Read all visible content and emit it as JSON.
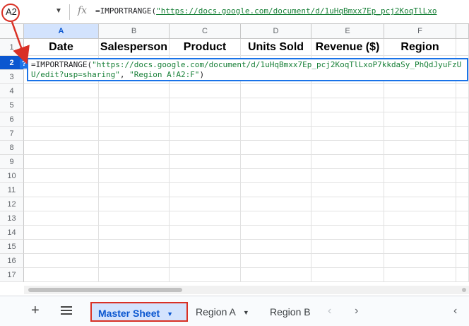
{
  "formula_bar": {
    "cell_ref": "A2",
    "fx_label": "fx",
    "formula_prefix": "=IMPORTRANGE(",
    "formula_url": "\"https://docs.google.com/document/d/1uHqBmxx7Ep_pcj2KoqTlLxo"
  },
  "grid": {
    "columns": [
      "A",
      "B",
      "C",
      "D",
      "E",
      "F"
    ],
    "rows": [
      "1",
      "2",
      "3",
      "4",
      "5",
      "6",
      "7",
      "8",
      "9",
      "10",
      "11",
      "12",
      "13",
      "14",
      "15",
      "16",
      "17"
    ],
    "header_row": [
      "Date",
      "Salesperson",
      "Product",
      "Units Sold",
      "Revenue ($)",
      "Region"
    ],
    "selected_column": "A",
    "selected_row": "2"
  },
  "editor": {
    "help_chip": "?",
    "prefix": "=IMPORTRANGE(",
    "url_line1": "\"https://docs.google.com/document/d/1uHqBmxx7Ep_pcj2KoqTlLxoP7kkdaSy_PhQ",
    "url_line2": "dJyuFzUU/edit?usp=sharing\"",
    "sep": ", ",
    "range_arg": "\"Region A!A2:F\"",
    "suffix": ")"
  },
  "sheet_tabs": {
    "add_label": "+",
    "tabs": [
      {
        "label": "Master Sheet",
        "active": true
      },
      {
        "label": "Region A",
        "active": false
      },
      {
        "label": "Region B",
        "active": false
      }
    ],
    "prev_arrow": "‹",
    "next_arrow": "›",
    "collapse_arrow": "‹"
  },
  "colors": {
    "accent": "#1a73e8",
    "annotation_red": "#d93025",
    "link_green": "#188038",
    "active_tab_bg": "#d3e3fd"
  }
}
